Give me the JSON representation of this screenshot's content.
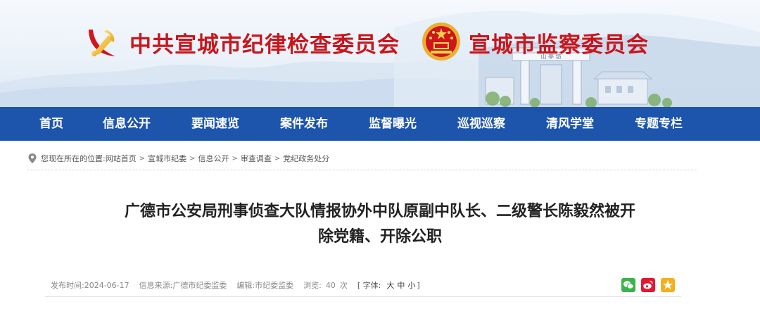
{
  "header": {
    "title_left": "中共宣城市纪律检查委员会",
    "title_right": "宣城市监察委员会",
    "left_emblem_icon": "party-emblem-icon",
    "right_emblem_icon": "national-emblem-icon",
    "arch_inscription": "山 亭 坊"
  },
  "nav": {
    "items": [
      {
        "label": "首页"
      },
      {
        "label": "信息公开"
      },
      {
        "label": "要闻速览"
      },
      {
        "label": "案件发布"
      },
      {
        "label": "监督曝光"
      },
      {
        "label": "巡视巡察"
      },
      {
        "label": "清风学堂"
      },
      {
        "label": "专题专栏"
      }
    ],
    "background": "#1d55ad"
  },
  "breadcrumb": {
    "prefix": "您现在所在的位置:",
    "items": [
      "网站首页",
      "宣城市纪委",
      "信息公开",
      "审查调查",
      "党纪政务处分"
    ],
    "separator": ">",
    "icon": "location-pin-icon"
  },
  "article": {
    "title_line1": "广德市公安局刑事侦查大队情报协外中队原副中队长、二级警长陈毅然被开",
    "title_line2": "除党籍、开除公职"
  },
  "meta": {
    "publish_label": "发布时间:",
    "publish_date": "2024-06-17",
    "source_label": "信息来源:",
    "source": "广德市纪委监委",
    "editor_label": "编辑:",
    "editor": "市纪委监委",
    "views_label": "浏览:",
    "views": "40",
    "views_unit": "次",
    "font_open": "[ 字体:",
    "font_large": "大",
    "font_medium": "中",
    "font_small": "小",
    "font_close": "]"
  },
  "share": {
    "icons": [
      "wechat-icon",
      "weibo-icon",
      "qzone-icon"
    ],
    "colors": {
      "wechat": "#3ab44a",
      "weibo": "#e6162d",
      "qzone": "#f4b01b"
    }
  },
  "colors": {
    "title_red": "#c8161d",
    "nav_blue": "#1d55ad"
  }
}
